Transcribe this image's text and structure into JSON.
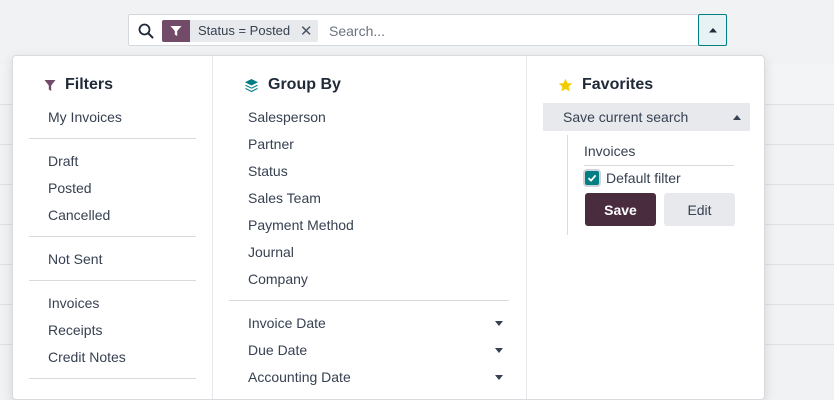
{
  "search": {
    "facet_label": "Status = Posted",
    "facet_remove": "✕",
    "placeholder": "Search..."
  },
  "filters": {
    "title": "Filters",
    "groups": [
      [
        "My Invoices"
      ],
      [
        "Draft",
        "Posted",
        "Cancelled"
      ],
      [
        "Not Sent"
      ],
      [
        "Invoices",
        "Receipts",
        "Credit Notes"
      ]
    ]
  },
  "group_by": {
    "title": "Group By",
    "items": [
      "Salesperson",
      "Partner",
      "Status",
      "Sales Team",
      "Payment Method",
      "Journal",
      "Company"
    ],
    "date_items": [
      "Invoice Date",
      "Due Date",
      "Accounting Date"
    ]
  },
  "favorites": {
    "title": "Favorites",
    "save_current_label": "Save current search",
    "name_value": "Invoices",
    "default_filter_label": "Default filter",
    "default_filter_checked": true,
    "save_label": "Save",
    "edit_label": "Edit"
  },
  "colors": {
    "brand": "#714b67",
    "save_button": "#4a2c3f",
    "accent": "#017e84",
    "star": "#f3cc00"
  }
}
